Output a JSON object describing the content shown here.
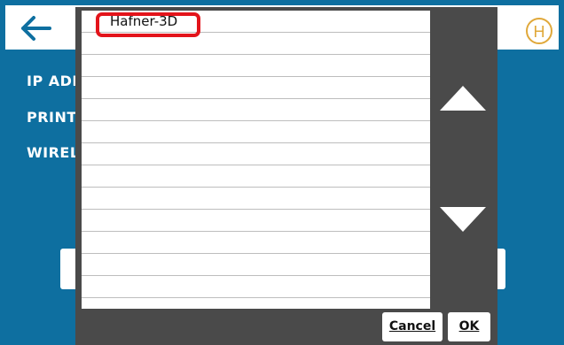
{
  "header": {
    "back_icon": "arrow-left-icon",
    "logo_letter": "H",
    "accent": "#e0a83a"
  },
  "background_labels": [
    "IP ADD",
    "PRINTI",
    "WIREL"
  ],
  "dialog": {
    "items": [
      "Hafner-3D",
      "",
      "",
      "",
      "",
      "",
      "",
      "",
      "",
      "",
      "",
      "",
      ""
    ],
    "cancel_label": "Cancel",
    "ok_label": "OK"
  },
  "colors": {
    "background": "#0e6fa0",
    "dialog": "#4a4a4a",
    "highlight": "#e3141b"
  }
}
